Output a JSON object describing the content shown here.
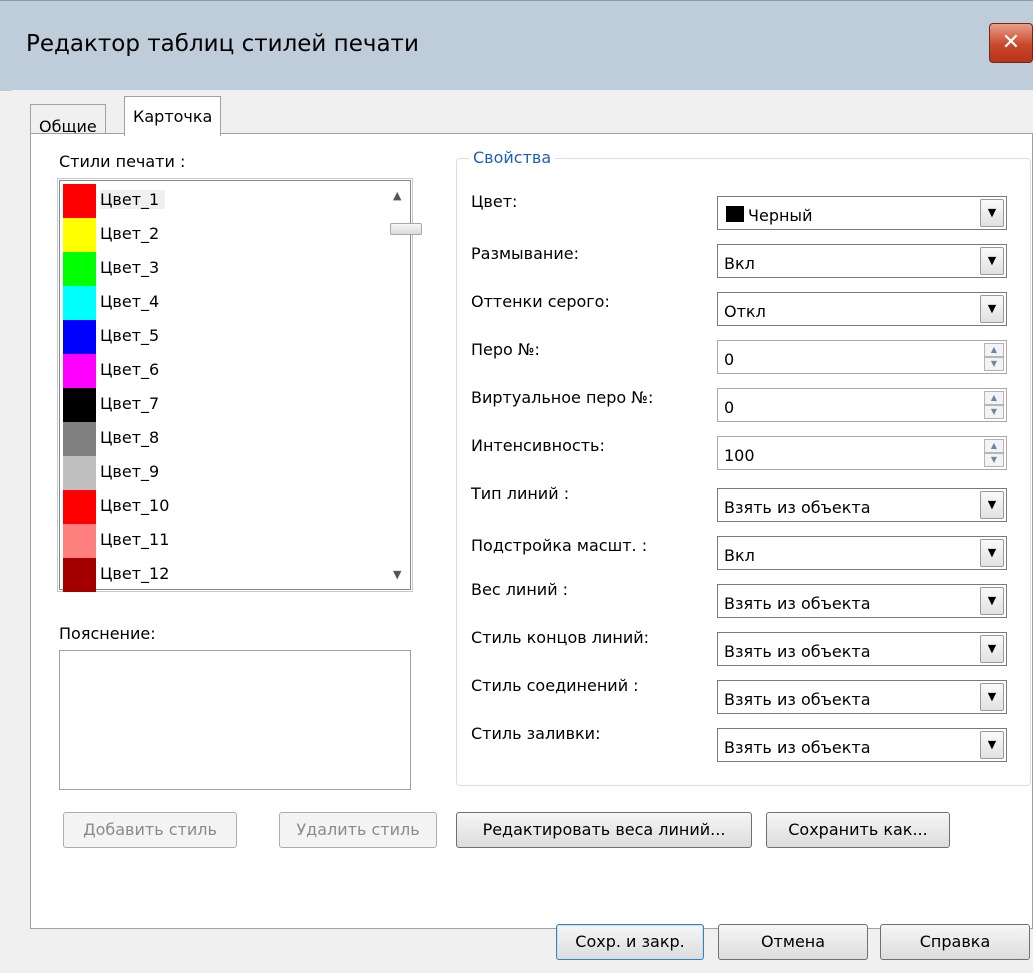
{
  "window": {
    "title": "Редактор таблиц стилей печати",
    "close_glyph": "✕"
  },
  "tabs": [
    {
      "label": "Общие",
      "active": false
    },
    {
      "label": "Карточка",
      "active": true
    }
  ],
  "styles": {
    "label": "Стили печати :",
    "selected_index": 0,
    "items": [
      {
        "name": "Цвет_1",
        "color": "#ff0000"
      },
      {
        "name": "Цвет_2",
        "color": "#ffff00"
      },
      {
        "name": "Цвет_3",
        "color": "#00ff00"
      },
      {
        "name": "Цвет_4",
        "color": "#00ffff"
      },
      {
        "name": "Цвет_5",
        "color": "#0000ff"
      },
      {
        "name": "Цвет_6",
        "color": "#ff00ff"
      },
      {
        "name": "Цвет_7",
        "color": "#000000"
      },
      {
        "name": "Цвет_8",
        "color": "#808080"
      },
      {
        "name": "Цвет_9",
        "color": "#c0c0c0"
      },
      {
        "name": "Цвет_10",
        "color": "#ff0000"
      },
      {
        "name": "Цвет_11",
        "color": "#ff7f7f"
      },
      {
        "name": "Цвет_12",
        "color": "#a50000"
      }
    ]
  },
  "note": {
    "label": "Пояснение:",
    "value": ""
  },
  "properties": {
    "legend": "Свойства",
    "color": {
      "label": "Цвет:",
      "value": "Черный",
      "swatch": "#000000"
    },
    "dither": {
      "label": "Размывание:",
      "value": "Вкл"
    },
    "grayscale": {
      "label": "Оттенки серого:",
      "value": "Откл"
    },
    "pen": {
      "label": "Перо №:",
      "value": "0"
    },
    "virtual_pen": {
      "label": "Виртуальное перо №:",
      "value": "0"
    },
    "intensity": {
      "label": "Интенсивность:",
      "value": "100"
    },
    "linetype": {
      "label": "Тип линий :",
      "value": "Взять из объекта"
    },
    "adaptive": {
      "label": "Подстройка масшт. :",
      "value": "Вкл"
    },
    "lineweight": {
      "label": "Вес линий :",
      "value": "Взять из объекта"
    },
    "line_end": {
      "label": "Стиль концов линий:",
      "value": "Взять из объекта"
    },
    "line_join": {
      "label": "Стиль соединений :",
      "value": "Взять из объекта"
    },
    "fill": {
      "label": "Стиль заливки:",
      "value": "Взять из объекта"
    }
  },
  "buttons": {
    "add_style": "Добавить стиль",
    "delete_style": "Удалить стиль",
    "edit_lineweights": "Редактировать веса линий...",
    "save_as": "Сохранить как...",
    "save_close": "Сохр. и закр.",
    "cancel": "Отмена",
    "help": "Справка"
  },
  "icons": {
    "dropdown": "chevron-down-icon",
    "spinner": "spin-arrows-icon"
  }
}
